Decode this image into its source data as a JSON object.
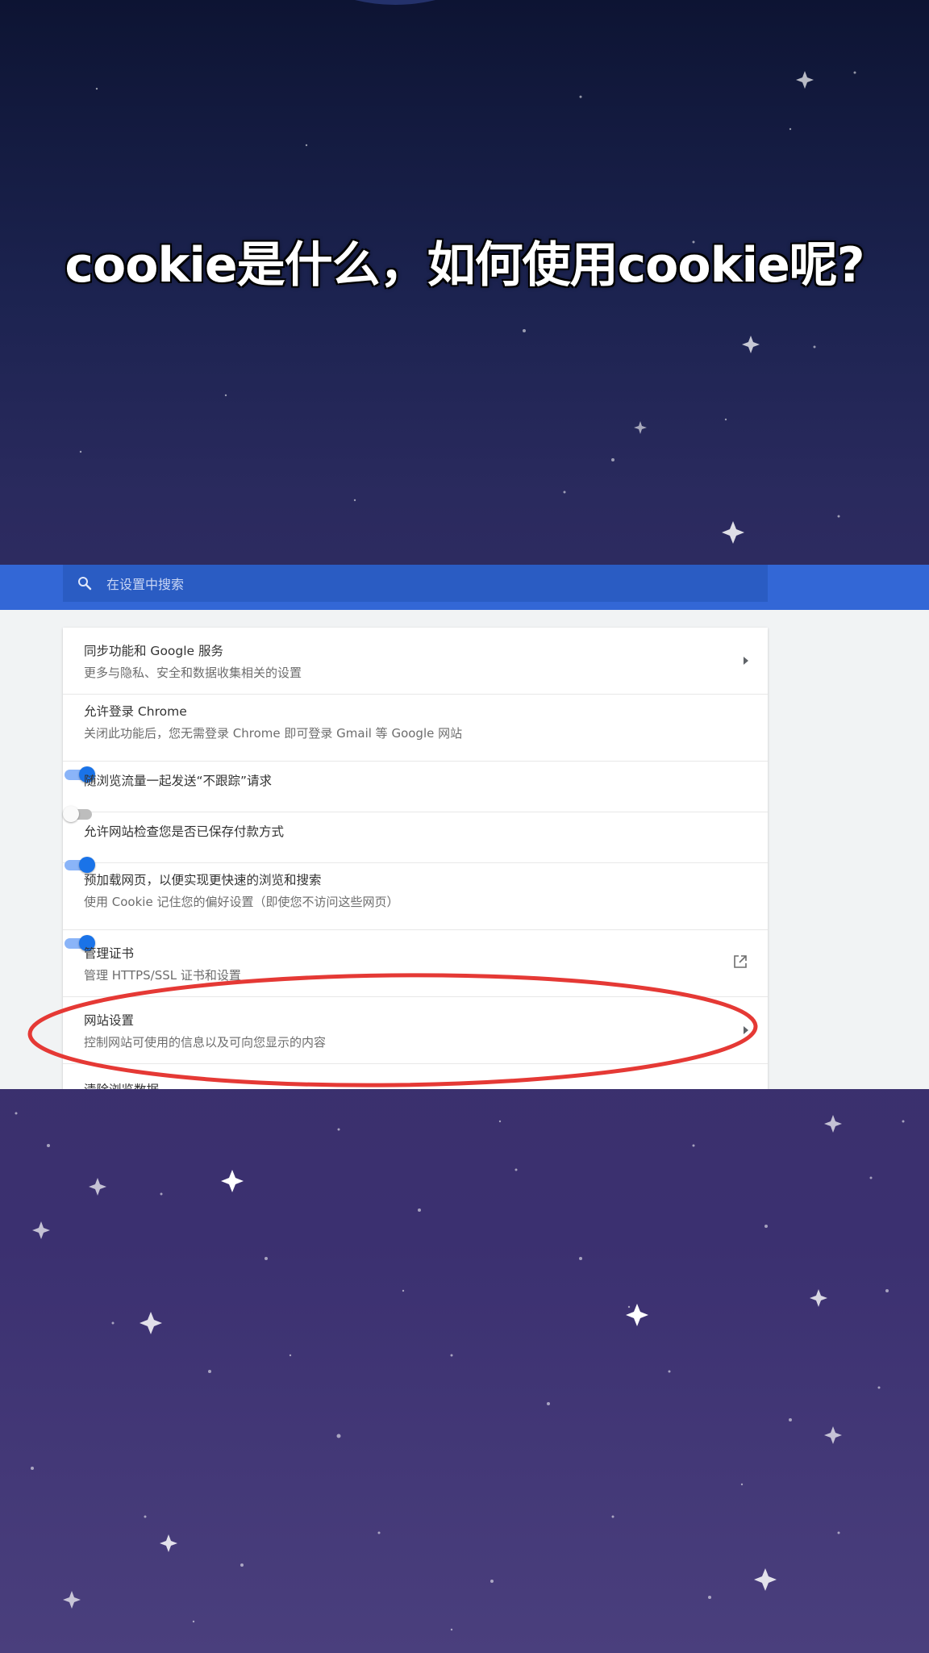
{
  "headline": "cookie是什么，如何使用cookie呢?",
  "search": {
    "placeholder": "在设置中搜索",
    "icon": "search-icon"
  },
  "settings": {
    "rows": [
      {
        "title": "同步功能和 Google 服务",
        "subtitle": "更多与隐私、安全和数据收集相关的设置",
        "control": "chevron"
      },
      {
        "title": "允许登录 Chrome",
        "subtitle": "关闭此功能后，您无需登录 Chrome 即可登录 Gmail 等 Google 网站",
        "control": "toggle-on"
      },
      {
        "title": "随浏览流量一起发送“不跟踪”请求",
        "control": "toggle-off"
      },
      {
        "title": "允许网站检查您是否已保存付款方式",
        "control": "toggle-on"
      },
      {
        "title": "预加载网页，以便实现更快速的浏览和搜索",
        "subtitle": "使用 Cookie 记住您的偏好设置（即使您不访问这些网页）",
        "control": "toggle-on"
      },
      {
        "title": "管理证书",
        "subtitle": "管理 HTTPS/SSL 证书和设置",
        "control": "external-link"
      },
      {
        "title": "网站设置",
        "subtitle": "控制网站可使用的信息以及可向您显示的内容",
        "control": "chevron"
      },
      {
        "title": "清除浏览数据"
      }
    ]
  },
  "colors": {
    "header_blue": "#3367d6",
    "toggle_on": "#1a73e8",
    "highlight_ellipse": "#e53935"
  }
}
